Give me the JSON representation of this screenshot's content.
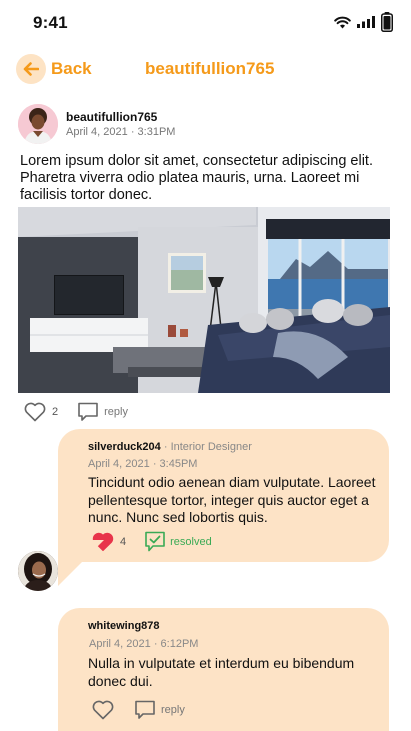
{
  "status_bar": {
    "time": "9:41"
  },
  "header": {
    "back_label": "Back",
    "title": "beautifullion765"
  },
  "post": {
    "user": "beautifullion765",
    "date": "April 4, 2021 · 3:31PM",
    "text": "Lorem ipsum dolor sit amet, consectetur adipiscing elit. Pharetra viverra odio platea mauris, urna. Laoreet mi facilisis tortor donec.",
    "likes": "2",
    "reply_label": "reply"
  },
  "comments": [
    {
      "user": "silverduck204",
      "role": "· Interior Designer",
      "date": "April 4, 2021 · 3:45PM",
      "text": "Tincidunt odio aenean diam vulputate. Laoreet pellentesque tortor, integer quis auctor eget a nunc. Nunc sed lobortis quis.",
      "likes": "4",
      "status_label": "resolved"
    },
    {
      "user": "whitewing878",
      "date": "April 4, 2021 · 6:12PM",
      "text": "Nulla in vulputate et interdum eu bibendum donec dui.",
      "reply_label": "reply"
    }
  ],
  "colors": {
    "accent": "#f59a1a",
    "bubble": "#fde3c6",
    "like_active": "#e8344a",
    "resolved": "#3aaa55"
  },
  "icons": [
    "wifi-icon",
    "signal-icon",
    "battery-icon",
    "back-arrow-icon",
    "heart-icon",
    "comment-icon",
    "resolved-check-icon"
  ]
}
